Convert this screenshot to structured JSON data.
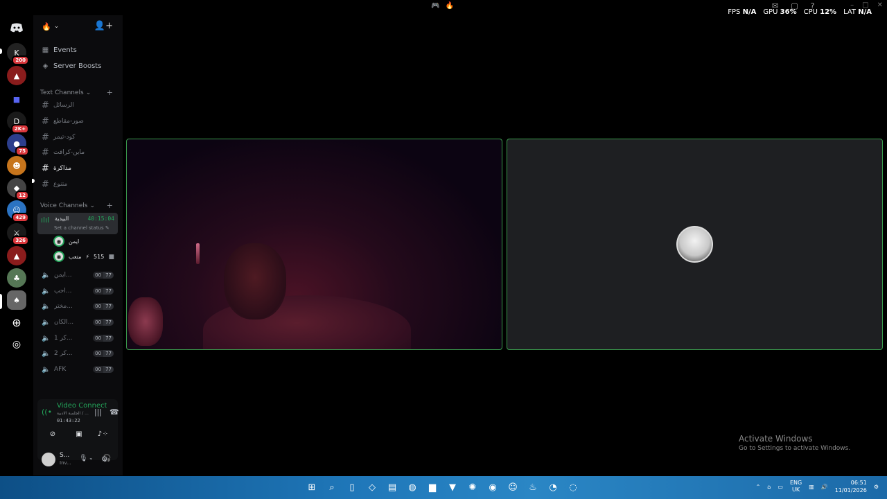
{
  "overlay": {
    "fps_label": "FPS",
    "fps_value": "N/A",
    "gpu_label": "GPU",
    "gpu_value": "36%",
    "cpu_label": "CPU",
    "cpu_value": "12%",
    "lat_label": "LAT",
    "lat_value": "N/A"
  },
  "rail": {
    "badges": [
      "200",
      "2K+",
      "75",
      "12",
      "429",
      "326"
    ]
  },
  "sidebar": {
    "events_label": "Events",
    "boosts_label": "Server Boosts",
    "text_category": "Text Channels",
    "text_channels": [
      "الرسائل",
      "صور-مقاطع",
      "كود-تيمر",
      "ماين-كرافت",
      "مذاكرة",
      "متنوع"
    ],
    "voice_category": "Voice Channels",
    "active_voice": {
      "name": "البيدية",
      "time": "40:15:04",
      "status": "Set a channel status"
    },
    "voice_users": [
      {
        "name": "ايمن"
      },
      {
        "name": "متعب",
        "extra": "515"
      }
    ],
    "voice_channels": [
      {
        "label": "ايمن...",
        "c1": "00",
        "c2": "77"
      },
      {
        "label": "احب...",
        "c1": "00",
        "c2": "77"
      },
      {
        "label": "مختر...",
        "c1": "00",
        "c2": "77"
      },
      {
        "label": "الكان...",
        "c1": "00",
        "c2": "77"
      },
      {
        "label": "1 كر...",
        "c1": "00",
        "c2": "77"
      },
      {
        "label": "2 كر...",
        "c1": "00",
        "c2": "77"
      },
      {
        "label": "AFK",
        "c1": "00",
        "c2": "77"
      }
    ]
  },
  "voice_panel": {
    "title": "Video Connected",
    "subtitle": "الجلسة الادبية / ...",
    "time": "01:43:22"
  },
  "user": {
    "name": "S...",
    "status": "Inv..."
  },
  "watermark": {
    "line1": "Activate Windows",
    "line2": "Go to Settings to activate Windows."
  },
  "tray": {
    "lang1": "ENG",
    "lang2": "UK",
    "time": "06:51",
    "date": "11/01/2026"
  }
}
